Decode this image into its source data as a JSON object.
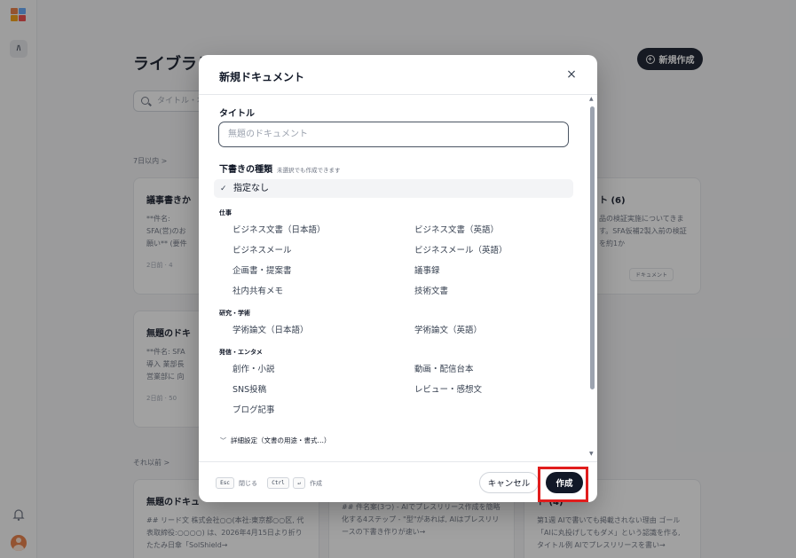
{
  "background": {
    "library_title": "ライブラリ",
    "new_button_label": "新規作成",
    "search_placeholder": "タイトル・本",
    "section_recent": "7日以内 >",
    "section_older": "それ以前 >",
    "cards": [
      {
        "title": "議事書きから",
        "body": "**件名: SFA(営)のお願い** (要件(要確認)です。",
        "meta": "2日前 · 4",
        "tag": ""
      },
      {
        "title": "ト (6)",
        "body": "品の検証実施についてきます。SFA仮補2製入前の検証を約1か",
        "meta": "",
        "tag": "ドキュメント"
      },
      {
        "title": "無題のドキュ",
        "body": "**件名: SFA導入 業部長 営業部に 向け, SFA導入の",
        "meta": "2日前 · 50",
        "tag": ""
      },
      {
        "title": "無題のドキュ",
        "body": "## リード文 株式会社○○(本社:東京都○○区, 代表取締役:○○○○) は、2026年4月15日より折りたたみ日傘「SolShield→",
        "meta": "",
        "tag": ""
      },
      {
        "title": "",
        "body": "## 件名案(3つ) - AIでプレスリリース作成を簡略化する4ステップ - \"型\"があれば, AIはプレスリリースの下書き作りが速い→",
        "meta": "",
        "tag": ""
      },
      {
        "title": "ト (4)",
        "body": "第1週 AIで書いても掲載されない理由 ゴール「AIに丸投げしてもダメ」という認識を作る, タイトル例 AIでプレスリリースを書い→",
        "meta": "",
        "tag": ""
      }
    ]
  },
  "sidebar": {
    "nav_label": "ﾊ"
  },
  "modal": {
    "title": "新規ドキュメント",
    "close_symbol": "×",
    "title_label": "タイトル",
    "title_placeholder": "無題のドキュメント",
    "title_value": "",
    "type_label": "下書きの種類",
    "type_hint": "未選択でも作成できます",
    "selected_option": {
      "check": "✓",
      "label": "指定なし"
    },
    "groups": [
      {
        "name": "仕事",
        "options": [
          "ビジネス文書（日本語）",
          "ビジネス文書（英語）",
          "ビジネスメール",
          "ビジネスメール（英語）",
          "企画書・提案書",
          "議事録",
          "社内共有メモ",
          "技術文書"
        ]
      },
      {
        "name": "研究・学術",
        "options": [
          "学術論文（日本語）",
          "学術論文（英語）"
        ]
      },
      {
        "name": "発信・エンタメ",
        "options": [
          "創作・小説",
          "動画・配信台本",
          "SNS投稿",
          "レビュー・感想文",
          "ブログ記事"
        ]
      }
    ],
    "advanced_label": "詳細設定（文書の用途・書式…）",
    "footer": {
      "esc_key": "Esc",
      "esc_hint": "閉じる",
      "ctrl_key": "Ctrl",
      "enter_key": "↵",
      "enter_hint": "作成",
      "cancel_label": "キャンセル",
      "create_label": "作成"
    }
  },
  "colors": {
    "accent_dark": "#111827",
    "highlight": "#e11d1d",
    "overlay": "rgba(30,30,30,0.42)"
  }
}
